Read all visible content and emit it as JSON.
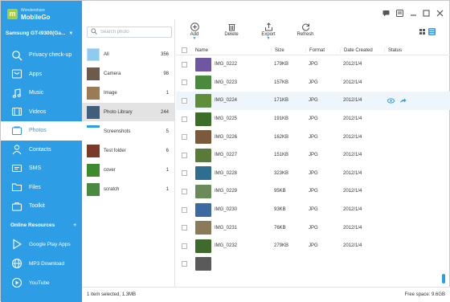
{
  "brand": {
    "small": "Wondershare",
    "name": "MobileGo"
  },
  "device": {
    "name": "Samsung GT-I9300(Ga..."
  },
  "nav": [
    {
      "label": "Privacy check-up",
      "icon": "magnifier-icon"
    },
    {
      "label": "Apps",
      "icon": "apps-icon"
    },
    {
      "label": "Music",
      "icon": "music-icon"
    },
    {
      "label": "Videos",
      "icon": "video-icon"
    },
    {
      "label": "Photos",
      "icon": "photo-icon"
    },
    {
      "label": "Contacts",
      "icon": "contacts-icon"
    },
    {
      "label": "SMS",
      "icon": "sms-icon"
    },
    {
      "label": "Files",
      "icon": "folder-icon"
    },
    {
      "label": "Toolkit",
      "icon": "toolkit-icon"
    }
  ],
  "resources": {
    "heading": "Online Resources",
    "add": "+",
    "items": [
      {
        "label": "Google Play Apps",
        "icon": "play-store-icon"
      },
      {
        "label": "MP3 Download",
        "icon": "globe-icon"
      },
      {
        "label": "YouTube",
        "icon": "play-circle-icon"
      }
    ]
  },
  "search": {
    "placeholder": "Search photo"
  },
  "albums": [
    {
      "name": "All",
      "count": "356",
      "color": "#8ecbf0"
    },
    {
      "name": "Camera",
      "count": "98",
      "color": "#6d5a4a"
    },
    {
      "name": "Image",
      "count": "1",
      "color": "#9b7b56"
    },
    {
      "name": "Photo Library",
      "count": "244",
      "color": "#3f5f7a"
    },
    {
      "name": "Screenshots",
      "count": "5",
      "color": "#2d9ee5"
    },
    {
      "name": "Test folder",
      "count": "6",
      "color": "#7a3a2a"
    },
    {
      "name": "cover",
      "count": "1",
      "color": "#3e8a2e"
    },
    {
      "name": "scratch",
      "count": "1",
      "color": "#4a8a40"
    }
  ],
  "toolbar": {
    "add": "Add",
    "delete": "Delete",
    "export": "Export",
    "refresh": "Refresh"
  },
  "table": {
    "headers": {
      "name": "Name",
      "size": "Size",
      "format": "Format",
      "date": "Date Created",
      "status": "Status"
    },
    "rows": [
      {
        "name": "IMG_0222",
        "size": "179KB",
        "format": "JPG",
        "date": "2012/1/4",
        "color": "#6e56a0"
      },
      {
        "name": "IMG_0223",
        "size": "157KB",
        "format": "JPG",
        "date": "2012/1/4",
        "color": "#4a8a3c"
      },
      {
        "name": "IMG_0224",
        "size": "171KB",
        "format": "JPG",
        "date": "2012/1/4",
        "color": "#5f8e3a"
      },
      {
        "name": "IMG_0225",
        "size": "191KB",
        "format": "JPG",
        "date": "2012/1/4",
        "color": "#3c6e2a"
      },
      {
        "name": "IMG_0226",
        "size": "162KB",
        "format": "JPG",
        "date": "2012/1/4",
        "color": "#7a5a3a"
      },
      {
        "name": "IMG_0227",
        "size": "151KB",
        "format": "JPG",
        "date": "2012/1/4",
        "color": "#5a7a3a"
      },
      {
        "name": "IMG_0228",
        "size": "323KB",
        "format": "JPG",
        "date": "2012/1/4",
        "color": "#2e6e8e"
      },
      {
        "name": "IMG_0229",
        "size": "95KB",
        "format": "JPG",
        "date": "2012/1/4",
        "color": "#6a8a5a"
      },
      {
        "name": "IMG_0230",
        "size": "93KB",
        "format": "JPG",
        "date": "2012/1/4",
        "color": "#3a6aa0"
      },
      {
        "name": "IMG_0231",
        "size": "76KB",
        "format": "JPG",
        "date": "2012/1/4",
        "color": "#8a7a5a"
      },
      {
        "name": "IMG_0232",
        "size": "279KB",
        "format": "JPG",
        "date": "2012/1/4",
        "color": "#3e6a2e"
      },
      {
        "name": "",
        "size": "",
        "format": "",
        "date": "",
        "color": "#5a5a5a"
      }
    ]
  },
  "status": {
    "selected": "1 item selected, 1.3MB",
    "free": "Free space: 9.6GB"
  },
  "colors": {
    "accent": "#2d9ee5",
    "sidebar": "#2d9ee5",
    "logo": "#a6ce39"
  }
}
